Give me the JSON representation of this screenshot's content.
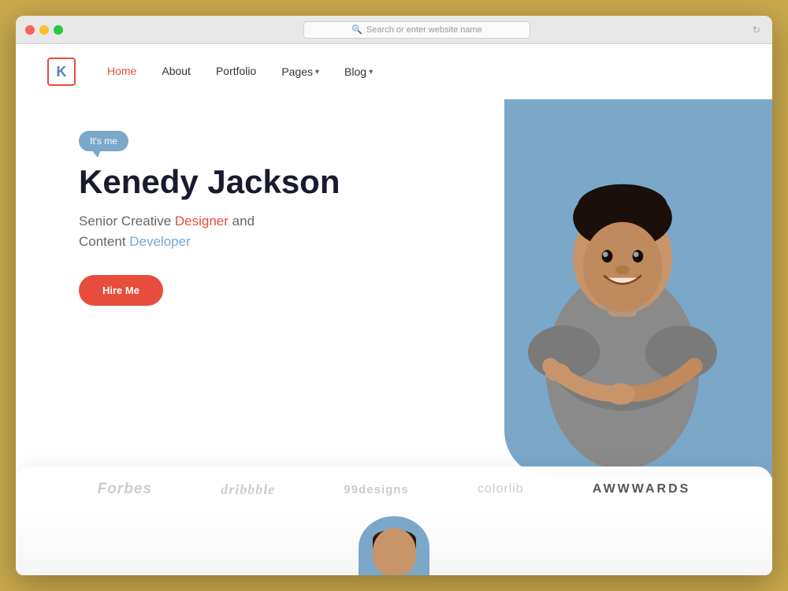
{
  "browser": {
    "address_placeholder": "Search or enter website name",
    "reload_icon": "↻"
  },
  "nav": {
    "logo_letter": "K",
    "links": [
      {
        "label": "Home",
        "active": true
      },
      {
        "label": "About",
        "active": false
      },
      {
        "label": "Portfolio",
        "active": false
      },
      {
        "label": "Pages",
        "has_arrow": true
      },
      {
        "label": "Blog",
        "has_arrow": true
      }
    ]
  },
  "hero": {
    "bubble_text": "It's me",
    "name": "Kenedy Jackson",
    "subtitle_before": "Senior Creative ",
    "subtitle_designer": "Designer",
    "subtitle_middle": " and\nContent ",
    "subtitle_developer": "Developer",
    "cta_button": "Hire Me"
  },
  "brands": [
    {
      "name": "Forbes",
      "style": "forbes"
    },
    {
      "name": "dribbble",
      "style": "dribbble"
    },
    {
      "name": "99designs",
      "style": "normal"
    },
    {
      "name": "colorlib",
      "style": "normal"
    },
    {
      "name": "AWWWARDS",
      "style": "awwwards"
    }
  ],
  "colors": {
    "accent_red": "#e74c3c",
    "accent_blue": "#7ba7c9",
    "text_dark": "#1a1a2e",
    "text_light": "#666",
    "brand_color_dim": "#bbb"
  }
}
